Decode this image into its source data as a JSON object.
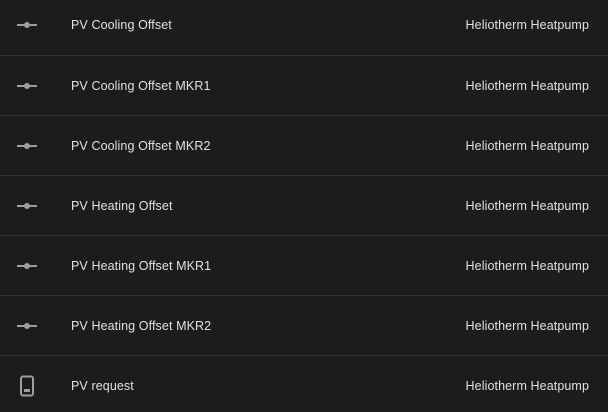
{
  "colors": {
    "background": "#1c1c1c",
    "divider": "#333333",
    "text": "#e1e1e1",
    "icon": "#9e9e9e"
  },
  "entities": [
    {
      "name": "PV Cooling Offset",
      "device": "Heliotherm Heatpump",
      "icon": "slider-icon"
    },
    {
      "name": "PV Cooling Offset MKR1",
      "device": "Heliotherm Heatpump",
      "icon": "slider-icon"
    },
    {
      "name": "PV Cooling Offset MKR2",
      "device": "Heliotherm Heatpump",
      "icon": "slider-icon"
    },
    {
      "name": "PV Heating Offset",
      "device": "Heliotherm Heatpump",
      "icon": "slider-icon"
    },
    {
      "name": "PV Heating Offset MKR1",
      "device": "Heliotherm Heatpump",
      "icon": "slider-icon"
    },
    {
      "name": "PV Heating Offset MKR2",
      "device": "Heliotherm Heatpump",
      "icon": "slider-icon"
    },
    {
      "name": "PV request",
      "device": "Heliotherm Heatpump",
      "icon": "switch-device-icon"
    }
  ]
}
